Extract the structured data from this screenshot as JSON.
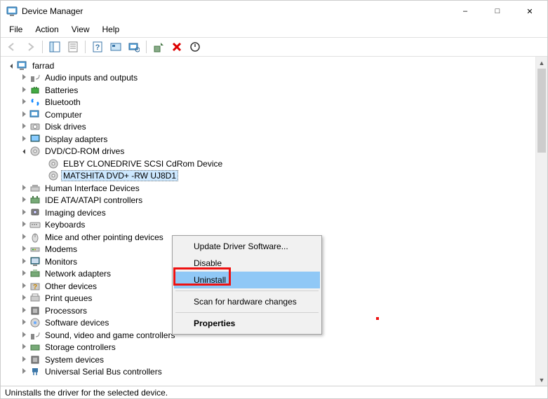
{
  "window": {
    "title": "Device Manager"
  },
  "menubar": {
    "file": "File",
    "action": "Action",
    "view": "View",
    "help": "Help"
  },
  "tree": {
    "root": "farrad",
    "items": [
      "Audio inputs and outputs",
      "Batteries",
      "Bluetooth",
      "Computer",
      "Disk drives",
      "Display adapters"
    ],
    "dvd_category": "DVD/CD-ROM drives",
    "dvd_children": [
      "ELBY CLONEDRIVE SCSI CdRom Device",
      "MATSHITA DVD+ -RW UJ8D1"
    ],
    "items2": [
      "Human Interface Devices",
      "IDE ATA/ATAPI controllers",
      "Imaging devices",
      "Keyboards",
      "Mice and other pointing devices",
      "Modems",
      "Monitors",
      "Network adapters",
      "Other devices",
      "Print queues",
      "Processors",
      "Software devices",
      "Sound, video and game controllers",
      "Storage controllers",
      "System devices",
      "Universal Serial Bus controllers"
    ]
  },
  "context_menu": {
    "update": "Update Driver Software...",
    "disable": "Disable",
    "uninstall": "Uninstall",
    "scan": "Scan for hardware changes",
    "properties": "Properties"
  },
  "statusbar": {
    "text": "Uninstalls the driver for the selected device."
  }
}
